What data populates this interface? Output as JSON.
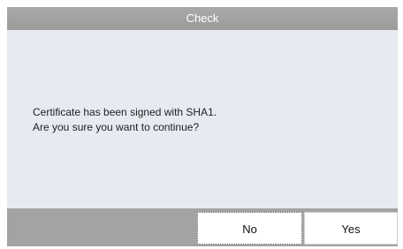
{
  "dialog": {
    "title": "Check",
    "message_lines": [
      "Certificate has been signed with SHA1.",
      "Are you sure you want to continue?"
    ],
    "buttons": {
      "no_label": "No",
      "yes_label": "Yes"
    }
  },
  "colors": {
    "title_bar": "#9e9e9e",
    "content_bg": "#e7eaf1",
    "button_bar": "#a3a3a3",
    "button_bg": "#ffffff"
  }
}
